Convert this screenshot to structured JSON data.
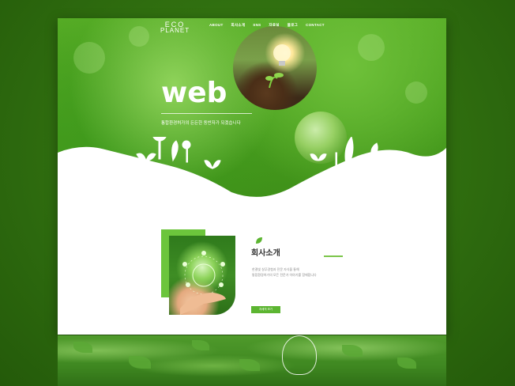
{
  "header": {
    "logo_line1": "ECO",
    "logo_line2": "PLANET",
    "nav": [
      "ABOUT",
      "회사소개",
      "SNS",
      "자료실",
      "블로그",
      "CONTACT"
    ]
  },
  "hero": {
    "title": "web",
    "subtitle": "통합환경허가의 든든한 동반자가 되겠습니다"
  },
  "about": {
    "title": "회사소개",
    "text_line1": "한결빛 실무경험과 전문 자식을 통해",
    "text_line2": "통합환경허가의 모든 전문가 이야기를 함께합니다",
    "button_label": "자세히 보기"
  },
  "colors": {
    "brand_green": "#5cb531",
    "dark_bg": "#2e6a10"
  },
  "icons": [
    "leaf-icon",
    "plant-icon",
    "bulb-icon",
    "globe-icon"
  ]
}
